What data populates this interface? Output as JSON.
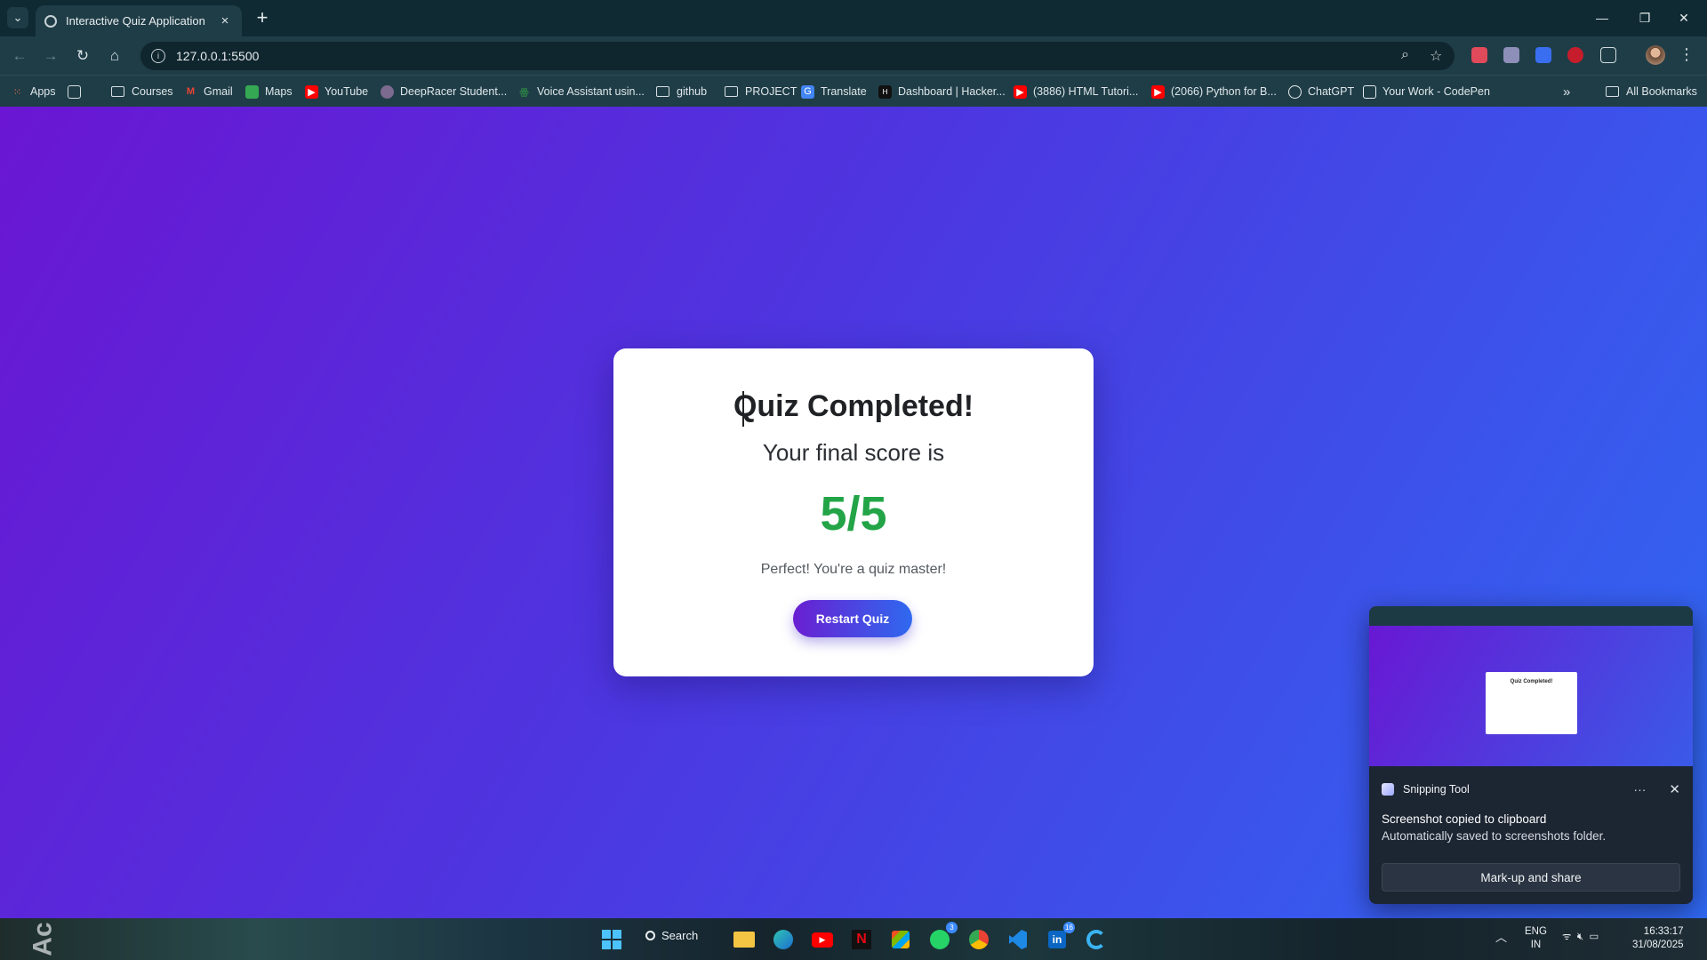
{
  "browser": {
    "tab_title": "Interactive Quiz Application",
    "tab_close": "×",
    "new_tab": "+",
    "url": "127.0.0.1:5500",
    "bookmarks": [
      {
        "label": "Apps",
        "icon": "apps-grid-icon"
      },
      {
        "label": "",
        "icon": "tab-groups-icon"
      },
      {
        "label": "Courses",
        "icon": "folder-icon"
      },
      {
        "label": "Gmail",
        "icon": "gmail-icon"
      },
      {
        "label": "Maps",
        "icon": "maps-icon"
      },
      {
        "label": "YouTube",
        "icon": "youtube-icon"
      },
      {
        "label": "DeepRacer Student...",
        "icon": "deepracer-icon"
      },
      {
        "label": "Voice Assistant usin...",
        "icon": "gfg-icon"
      },
      {
        "label": "github",
        "icon": "folder-icon"
      },
      {
        "label": "PROJECT",
        "icon": "folder-icon"
      },
      {
        "label": "Translate",
        "icon": "translate-icon"
      },
      {
        "label": "Dashboard | Hacker...",
        "icon": "hackerrank-icon"
      },
      {
        "label": "(3886) HTML Tutori...",
        "icon": "youtube-icon"
      },
      {
        "label": "(2066) Python for B...",
        "icon": "youtube-icon"
      },
      {
        "label": "ChatGPT",
        "icon": "chatgpt-icon"
      },
      {
        "label": "Your Work - CodePen",
        "icon": "codepen-icon"
      }
    ],
    "more_bookmarks": "»",
    "all_bookmarks": "All Bookmarks"
  },
  "quiz": {
    "heading": "Quiz Completed!",
    "subtitle": "Your final score is",
    "score": "5/5",
    "message": "Perfect! You're a quiz master!",
    "restart_label": "Restart Quiz",
    "score_color": "#22a447",
    "gradient_start": "#6a16d2",
    "gradient_end": "#2f68f2"
  },
  "toast": {
    "app_name": "Snipping Tool",
    "title": "Screenshot copied to clipboard",
    "body": "Automatically saved to screenshots folder.",
    "action_label": "Mark-up and share",
    "preview_heading": "Quiz Completed!"
  },
  "taskbar": {
    "search_label": "Search",
    "whatsapp_badge": "3",
    "linkedin_badge": "16",
    "language_line1": "ENG",
    "language_line2": "IN",
    "time": "16:33:17",
    "date": "31/08/2025",
    "activate_text": "Ac"
  }
}
